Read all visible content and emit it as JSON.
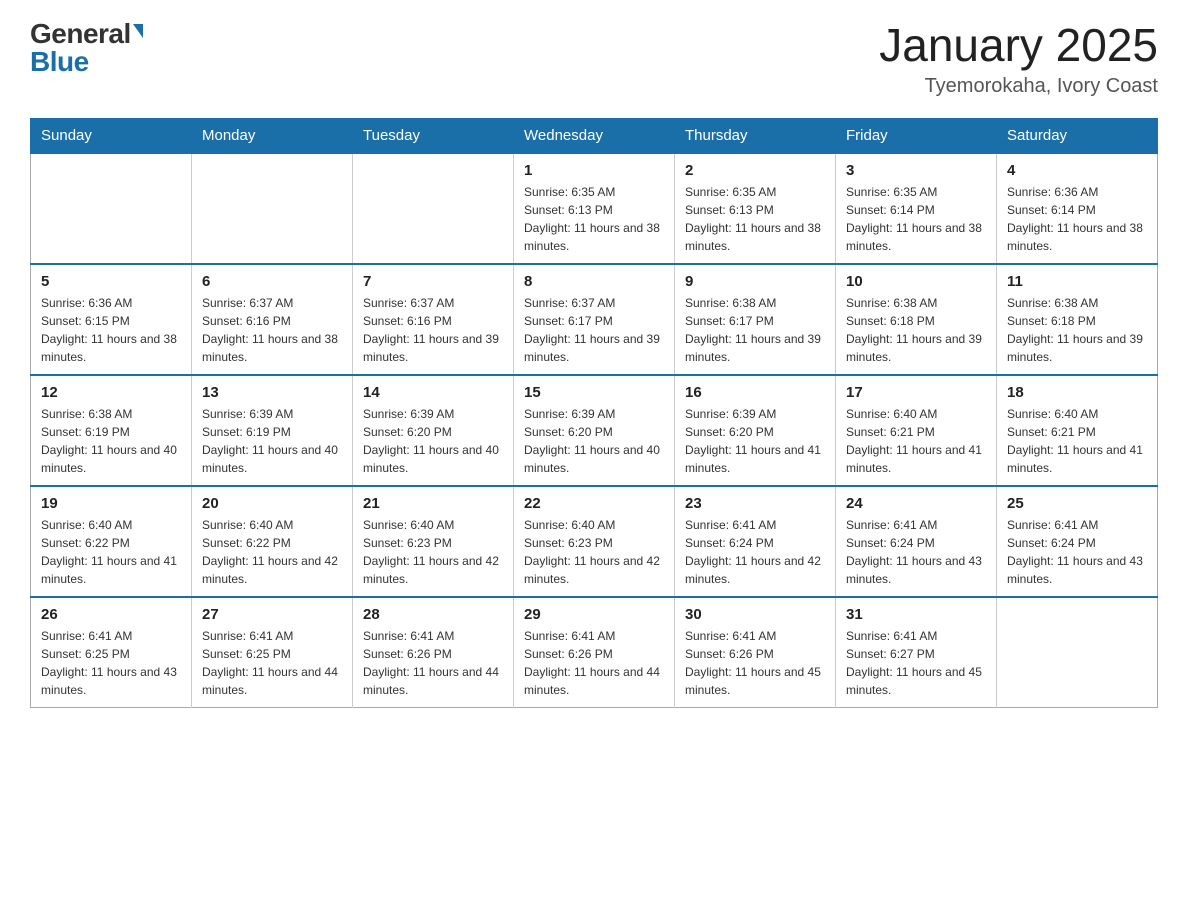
{
  "logo": {
    "general": "General",
    "blue": "Blue"
  },
  "title": "January 2025",
  "subtitle": "Tyemorokaha, Ivory Coast",
  "days_of_week": [
    "Sunday",
    "Monday",
    "Tuesday",
    "Wednesday",
    "Thursday",
    "Friday",
    "Saturday"
  ],
  "weeks": [
    [
      {
        "day": "",
        "info": ""
      },
      {
        "day": "",
        "info": ""
      },
      {
        "day": "",
        "info": ""
      },
      {
        "day": "1",
        "info": "Sunrise: 6:35 AM\nSunset: 6:13 PM\nDaylight: 11 hours and 38 minutes."
      },
      {
        "day": "2",
        "info": "Sunrise: 6:35 AM\nSunset: 6:13 PM\nDaylight: 11 hours and 38 minutes."
      },
      {
        "day": "3",
        "info": "Sunrise: 6:35 AM\nSunset: 6:14 PM\nDaylight: 11 hours and 38 minutes."
      },
      {
        "day": "4",
        "info": "Sunrise: 6:36 AM\nSunset: 6:14 PM\nDaylight: 11 hours and 38 minutes."
      }
    ],
    [
      {
        "day": "5",
        "info": "Sunrise: 6:36 AM\nSunset: 6:15 PM\nDaylight: 11 hours and 38 minutes."
      },
      {
        "day": "6",
        "info": "Sunrise: 6:37 AM\nSunset: 6:16 PM\nDaylight: 11 hours and 38 minutes."
      },
      {
        "day": "7",
        "info": "Sunrise: 6:37 AM\nSunset: 6:16 PM\nDaylight: 11 hours and 39 minutes."
      },
      {
        "day": "8",
        "info": "Sunrise: 6:37 AM\nSunset: 6:17 PM\nDaylight: 11 hours and 39 minutes."
      },
      {
        "day": "9",
        "info": "Sunrise: 6:38 AM\nSunset: 6:17 PM\nDaylight: 11 hours and 39 minutes."
      },
      {
        "day": "10",
        "info": "Sunrise: 6:38 AM\nSunset: 6:18 PM\nDaylight: 11 hours and 39 minutes."
      },
      {
        "day": "11",
        "info": "Sunrise: 6:38 AM\nSunset: 6:18 PM\nDaylight: 11 hours and 39 minutes."
      }
    ],
    [
      {
        "day": "12",
        "info": "Sunrise: 6:38 AM\nSunset: 6:19 PM\nDaylight: 11 hours and 40 minutes."
      },
      {
        "day": "13",
        "info": "Sunrise: 6:39 AM\nSunset: 6:19 PM\nDaylight: 11 hours and 40 minutes."
      },
      {
        "day": "14",
        "info": "Sunrise: 6:39 AM\nSunset: 6:20 PM\nDaylight: 11 hours and 40 minutes."
      },
      {
        "day": "15",
        "info": "Sunrise: 6:39 AM\nSunset: 6:20 PM\nDaylight: 11 hours and 40 minutes."
      },
      {
        "day": "16",
        "info": "Sunrise: 6:39 AM\nSunset: 6:20 PM\nDaylight: 11 hours and 41 minutes."
      },
      {
        "day": "17",
        "info": "Sunrise: 6:40 AM\nSunset: 6:21 PM\nDaylight: 11 hours and 41 minutes."
      },
      {
        "day": "18",
        "info": "Sunrise: 6:40 AM\nSunset: 6:21 PM\nDaylight: 11 hours and 41 minutes."
      }
    ],
    [
      {
        "day": "19",
        "info": "Sunrise: 6:40 AM\nSunset: 6:22 PM\nDaylight: 11 hours and 41 minutes."
      },
      {
        "day": "20",
        "info": "Sunrise: 6:40 AM\nSunset: 6:22 PM\nDaylight: 11 hours and 42 minutes."
      },
      {
        "day": "21",
        "info": "Sunrise: 6:40 AM\nSunset: 6:23 PM\nDaylight: 11 hours and 42 minutes."
      },
      {
        "day": "22",
        "info": "Sunrise: 6:40 AM\nSunset: 6:23 PM\nDaylight: 11 hours and 42 minutes."
      },
      {
        "day": "23",
        "info": "Sunrise: 6:41 AM\nSunset: 6:24 PM\nDaylight: 11 hours and 42 minutes."
      },
      {
        "day": "24",
        "info": "Sunrise: 6:41 AM\nSunset: 6:24 PM\nDaylight: 11 hours and 43 minutes."
      },
      {
        "day": "25",
        "info": "Sunrise: 6:41 AM\nSunset: 6:24 PM\nDaylight: 11 hours and 43 minutes."
      }
    ],
    [
      {
        "day": "26",
        "info": "Sunrise: 6:41 AM\nSunset: 6:25 PM\nDaylight: 11 hours and 43 minutes."
      },
      {
        "day": "27",
        "info": "Sunrise: 6:41 AM\nSunset: 6:25 PM\nDaylight: 11 hours and 44 minutes."
      },
      {
        "day": "28",
        "info": "Sunrise: 6:41 AM\nSunset: 6:26 PM\nDaylight: 11 hours and 44 minutes."
      },
      {
        "day": "29",
        "info": "Sunrise: 6:41 AM\nSunset: 6:26 PM\nDaylight: 11 hours and 44 minutes."
      },
      {
        "day": "30",
        "info": "Sunrise: 6:41 AM\nSunset: 6:26 PM\nDaylight: 11 hours and 45 minutes."
      },
      {
        "day": "31",
        "info": "Sunrise: 6:41 AM\nSunset: 6:27 PM\nDaylight: 11 hours and 45 minutes."
      },
      {
        "day": "",
        "info": ""
      }
    ]
  ]
}
